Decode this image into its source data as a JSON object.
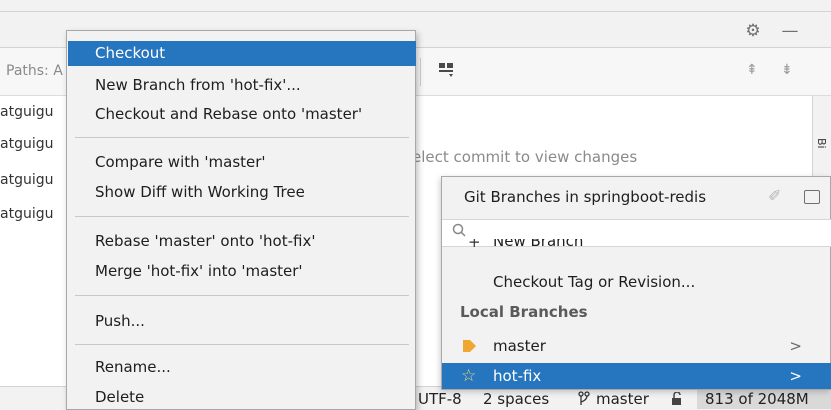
{
  "toolwindow": {
    "gear_icon": "gear-icon",
    "minimize_icon": "minimize-icon",
    "paths_label": "Paths: A",
    "log_authors": [
      "atguigu",
      "atguigu",
      "atguigu",
      "atguigu"
    ],
    "empty_details_text": "elect commit to view changes",
    "side_label": "Bi"
  },
  "context_menu": {
    "items": [
      {
        "label": "Checkout",
        "selected": true
      },
      {
        "label": "New Branch from 'hot-fix'..."
      },
      {
        "label": "Checkout and Rebase onto 'master'"
      },
      {
        "label": "Compare with 'master'"
      },
      {
        "label": "Show Diff with Working Tree"
      },
      {
        "label": "Rebase 'master' onto 'hot-fix'"
      },
      {
        "label": "Merge 'hot-fix' into 'master'"
      },
      {
        "label": "Push..."
      },
      {
        "label": "Rename..."
      },
      {
        "label": "Delete"
      }
    ]
  },
  "branches_popup": {
    "title": "Git Branches in springboot-redis",
    "search_placeholder": "",
    "new_branch_label": "New Branch",
    "checkout_tag_label": "Checkout Tag or Revision...",
    "local_section": "Local Branches",
    "local_branches": [
      {
        "name": "master",
        "icon": "tag-icon",
        "selected": false
      },
      {
        "name": "hot-fix",
        "icon": "star-icon",
        "selected": true
      }
    ]
  },
  "status_bar": {
    "encoding": "UTF-8",
    "indent": "2 spaces",
    "branch": "master",
    "memory": "813 of 2048M"
  },
  "colors": {
    "selection": "#2675bf",
    "menu_bg": "#f2f2f2"
  }
}
